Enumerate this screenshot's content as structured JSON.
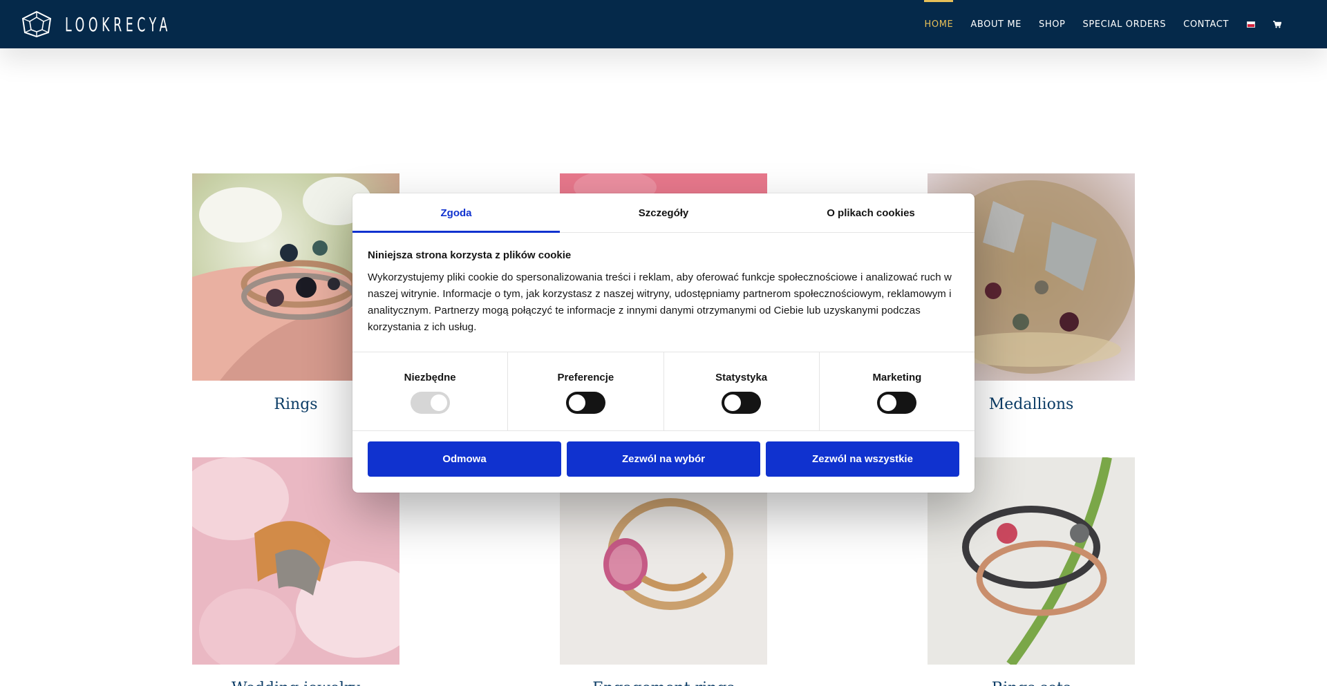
{
  "header": {
    "logo_text": "LOOKRECYA",
    "nav": [
      {
        "label": "HOME",
        "active": true
      },
      {
        "label": "ABOUT ME",
        "active": false
      },
      {
        "label": "SHOP",
        "active": false
      },
      {
        "label": "SPECIAL ORDERS",
        "active": false
      },
      {
        "label": "CONTACT",
        "active": false
      }
    ],
    "language_flag_icon": "poland-flag-icon",
    "cart_icon": "cart-icon",
    "colors": {
      "background": "#05294a",
      "active": "#e6bf58"
    }
  },
  "categories": [
    {
      "label": "Rings"
    },
    {
      "label": ""
    },
    {
      "label": "Medallions"
    },
    {
      "label": "Wedding jewelry"
    },
    {
      "label": "Engagement rings"
    },
    {
      "label": "Rings sets"
    }
  ],
  "cookie_dialog": {
    "tabs": [
      {
        "label": "Zgoda",
        "active": true
      },
      {
        "label": "Szczegóły",
        "active": false
      },
      {
        "label": "O plikach cookies",
        "active": false
      }
    ],
    "title": "Niniejsza strona korzysta z plików cookie",
    "text": "Wykorzystujemy pliki cookie do spersonalizowania treści i reklam, aby oferować funkcje społecznościowe i analizować ruch w naszej witrynie. Informacje o tym, jak korzystasz z naszej witryny, udostępniamy partnerom społecznościowym, reklamowym i analitycznym. Partnerzy mogą połączyć te informacje z innymi danymi otrzymanymi od Ciebie lub uzyskanymi podczas korzystania z ich usług.",
    "toggles": [
      {
        "label": "Niezbędne",
        "enabled": true,
        "disabled": true
      },
      {
        "label": "Preferencje",
        "enabled": false,
        "disabled": false
      },
      {
        "label": "Statystyka",
        "enabled": false,
        "disabled": false
      },
      {
        "label": "Marketing",
        "enabled": false,
        "disabled": false
      }
    ],
    "buttons": {
      "deny": "Odmowa",
      "allow_selection": "Zezwól na wybór",
      "allow_all": "Zezwól na wszystkie"
    },
    "accent_color": "#1032cf"
  }
}
